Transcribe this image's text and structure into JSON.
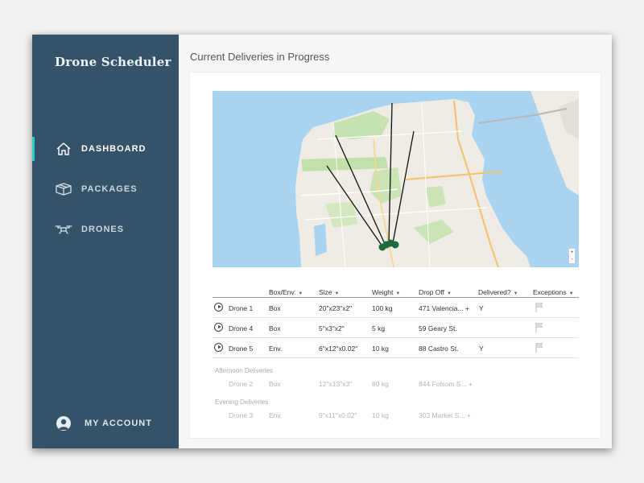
{
  "app": {
    "title": "Drone Scheduler"
  },
  "sidebar": {
    "items": [
      {
        "label": "DASHBOARD",
        "icon": "home-icon",
        "active": true
      },
      {
        "label": "PACKAGES",
        "icon": "package-box-icon",
        "active": false
      },
      {
        "label": "DRONES",
        "icon": "drone-icon",
        "active": false
      }
    ],
    "account": {
      "label": "MY ACCOUNT",
      "icon": "user-avatar-icon"
    }
  },
  "main": {
    "title": "Current Deliveries in Progress",
    "map": {
      "zoom_in": "+",
      "zoom_out": "-"
    },
    "table": {
      "columns": [
        "Box/Env.",
        "Size",
        "Weight",
        "Drop Off",
        "Delivered?",
        "Exceptions"
      ],
      "current": [
        {
          "drone": "Drone 1",
          "type": "Box",
          "size": "20\"x23\"x2\"",
          "weight": "100 kg",
          "dropoff": "471 Valencia... +",
          "delivered": "Y"
        },
        {
          "drone": "Drone 4",
          "type": "Box",
          "size": "5\"x3\"x2\"",
          "weight": "5 kg",
          "dropoff": "59 Geary St.",
          "delivered": ""
        },
        {
          "drone": "Drone 5",
          "type": "Env.",
          "size": "6\"x12\"x0.02\"",
          "weight": "10 kg",
          "dropoff": "88 Castro St.",
          "delivered": "Y"
        }
      ],
      "afternoon": {
        "label": "Afternoon Deliveries",
        "rows": [
          {
            "drone": "Drone 2",
            "type": "Box",
            "size": "12\"x13\"x3\"",
            "weight": "80 kg",
            "dropoff": "844 Folsom S... +"
          }
        ]
      },
      "evening": {
        "label": "Evening Deliveries",
        "rows": [
          {
            "drone": "Drone 3",
            "type": "Env.",
            "size": "9\"x11\"x0.02\"",
            "weight": "10 kg",
            "dropoff": "303 Market S... +"
          }
        ]
      }
    }
  },
  "colors": {
    "sidebar": "#355368",
    "accent": "#2ad0c4",
    "marker": "#1e6b3c"
  }
}
